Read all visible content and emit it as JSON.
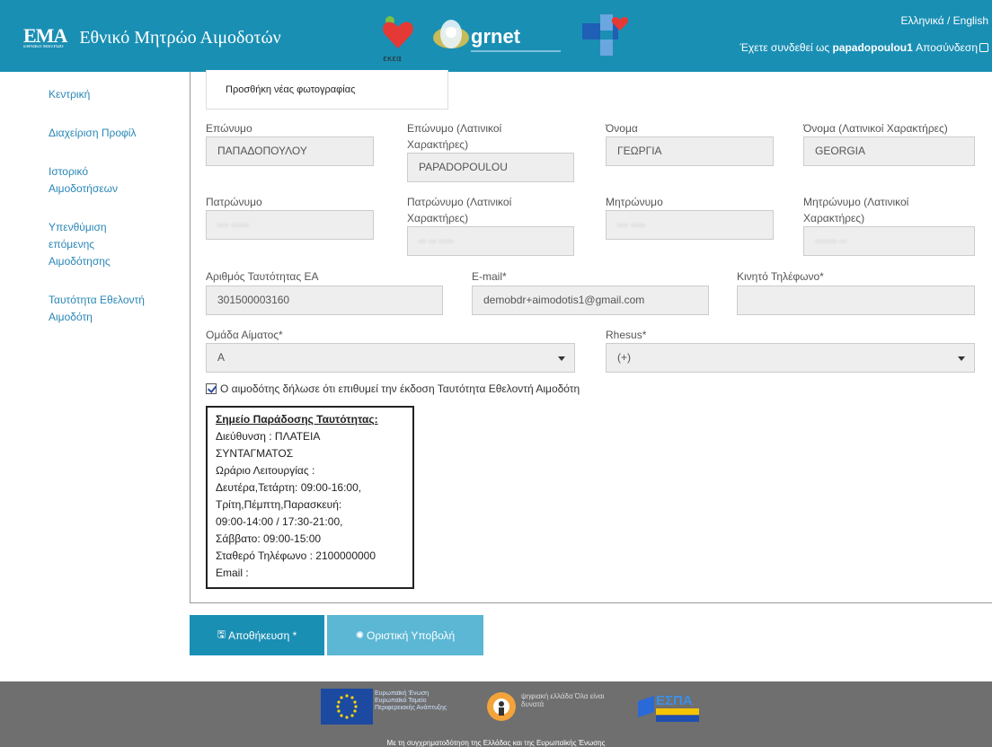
{
  "header": {
    "brand_mark": "EMA",
    "brand_title": "Εθνικό Μητρώο Αιμοδοτών",
    "language": "Ελληνικά / English",
    "login_prefix": "Έχετε συνδεθεί ως",
    "username": "papadopoulou1",
    "logout": "Αποσύνδεση",
    "ekea_logo_text": "εκεα",
    "grnet_logo_text": "grnet"
  },
  "sidebar": {
    "items": [
      {
        "label": "Κεντρική"
      },
      {
        "label": "Διαχείριση Προφίλ"
      },
      {
        "label": "Ιστορικό Αιμοδοτήσεων"
      },
      {
        "label": "Υπενθύμιση επόμενης Αιμοδότησης"
      },
      {
        "label": "Ταυτότητα Εθελοντή Αιμοδότη"
      }
    ]
  },
  "photo": {
    "caption": "Προσθήκη νέας φωτογραφίας"
  },
  "form": {
    "surname": {
      "label": "Επώνυμο",
      "value": "ΠΑΠΑΔΟΠΟΥΛΟΥ"
    },
    "surname_latin": {
      "label": "Επώνυμο (Λατινικοί Χαρακτήρες)",
      "value": "PAPADOPOULOU"
    },
    "name": {
      "label": "Όνομα",
      "value": "ΓΕΩΡΓΙΑ"
    },
    "name_latin": {
      "label": "Όνομα (Λατινικοί Χαρακτήρες)",
      "value": "GEORGIA"
    },
    "father": {
      "label": "Πατρώνυμο",
      "value": "··· ·····"
    },
    "father_latin": {
      "label": "Πατρώνυμο (Λατινικοί Χαρακτήρες)",
      "value": "·· ·· ····"
    },
    "mother": {
      "label": "Μητρώνυμο",
      "value": "··· ····"
    },
    "mother_latin": {
      "label": "Μητρώνυμο (Λατινικοί Χαρακτήρες)",
      "value": "······ ··"
    },
    "id_number": {
      "label": "Αριθμός Ταυτότητας ΕΑ",
      "value": "301500003160"
    },
    "email": {
      "label": "E-mail*",
      "value": "demobdr+aimodotis1@gmail.com"
    },
    "mobile": {
      "label": "Κινητό Τηλέφωνο*",
      "value": ""
    },
    "blood_group": {
      "label": "Ομάδα Αίματος*",
      "value": "A"
    },
    "rhesus": {
      "label": "Rhesus*",
      "value": "(+)"
    }
  },
  "consent": {
    "label": "Ο αιμοδότης δήλωσε ότι επιθυμεί την έκδοση Ταυτότητα Εθελοντή Αιμοδότη",
    "checked": true
  },
  "delivery": {
    "title": "Σημείο Παράδοσης Ταυτότητας:",
    "lines": [
      "Διεύθυνση : ΠΛΑΤΕΙΑ",
      "ΣΥΝΤΑΓΜΑΤΟΣ",
      "Ωράριο Λειτουργίας :",
      "Δευτέρα,Τετάρτη: 09:00-16:00,",
      "Τρίτη,Πέμπτη,Παρασκευή:",
      "09:00-14:00 / 17:30-21:00,",
      "Σάββατο: 09:00-15:00",
      "Σταθερό Τηλέφωνο : 2100000000",
      "Email :"
    ]
  },
  "buttons": {
    "save": "Αποθήκευση *",
    "submit": "Οριστική Υποβολή"
  },
  "footer": {
    "eu_text": "Ευρωπαϊκή Ένωση Ευρωπαϊκό Ταμείο Περιφερειακής Ανάπτυξης",
    "digital_text": "ψηφιακή ελλάδα Όλα είναι δυνατά",
    "espa": "ΕΣΠΑ",
    "note": "Με τη συγχρηματοδότηση της Ελλάδας και της Ευρωπαϊκής Ένωσης"
  },
  "colors": {
    "header": "#1a8fb4",
    "link": "#2a87b6",
    "save_button": "#1a8fb4",
    "submit_button": "#5bb7d4",
    "footer": "#6f6f6f"
  }
}
